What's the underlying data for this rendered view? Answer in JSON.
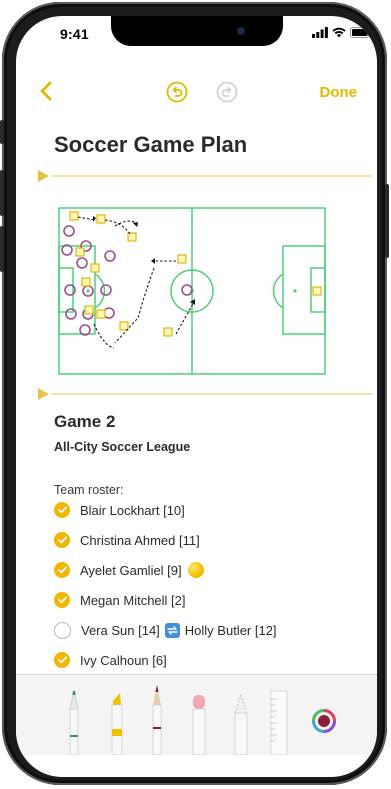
{
  "status_bar": {
    "time": "9:41"
  },
  "nav": {
    "done_label": "Done"
  },
  "note": {
    "title": "Soccer Game Plan",
    "game_title": "Game 2",
    "league": "All-City Soccer League",
    "roster_label": "Team roster:",
    "roster": [
      {
        "name": "Blair Lockhart [10]",
        "checked": true
      },
      {
        "name": "Christina Ahmed [11]",
        "checked": true
      },
      {
        "name": "Ayelet Gamliel [9]",
        "checked": true,
        "emoji": "soccer-ball"
      },
      {
        "name": "Megan Mitchell [2]",
        "checked": true
      },
      {
        "name": "Vera Sun [14]",
        "checked": false,
        "swap_icon": "arrows-swap-icon",
        "name2": "Holly Butler [12]"
      },
      {
        "name": "Ivy Calhoun [6]",
        "checked": true
      }
    ]
  },
  "drawing_tools": [
    "pen",
    "marker",
    "pencil",
    "eraser",
    "lasso",
    "ruler",
    "color-picker"
  ],
  "colors": {
    "accent": "#e5b800",
    "field_lines": "#4fcf7a",
    "player_markers": "#9b4f8f",
    "check": "#f2b600"
  }
}
